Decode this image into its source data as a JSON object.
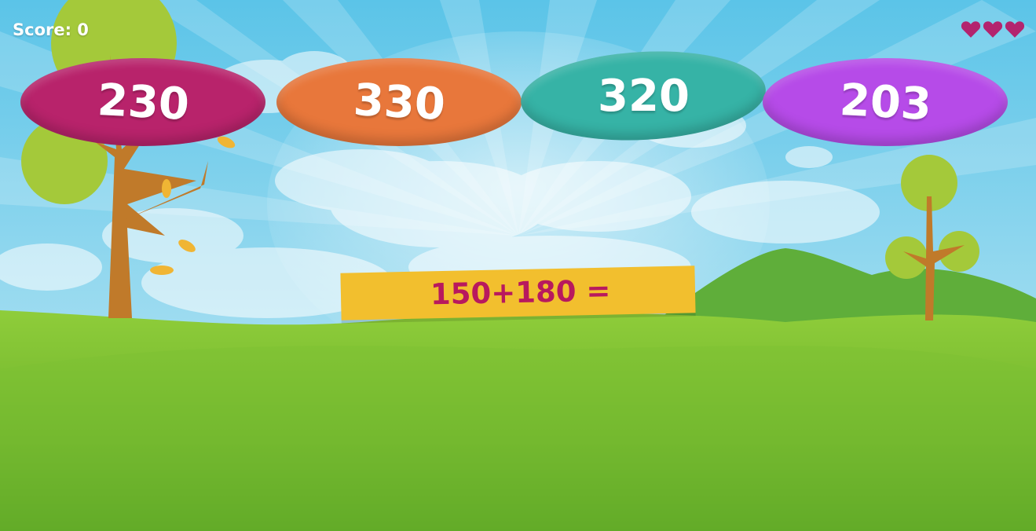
{
  "hud": {
    "score_text": "Score: 0",
    "lives": 3,
    "heart_color": "#b3246e"
  },
  "answers": [
    {
      "label": "230",
      "color": "#b8236b"
    },
    {
      "label": "330",
      "color": "#e8773b"
    },
    {
      "label": "320",
      "color": "#36b3a6"
    },
    {
      "label": "203",
      "color": "#b64be8"
    }
  ],
  "question": {
    "text": "150+180 =",
    "board_color": "#f2bf2e"
  },
  "colors": {
    "sky_top": "#5bc4e8",
    "sky_bottom": "#c8ebf5",
    "grass_light": "#8fcd3a",
    "grass_dark": "#4e9a20",
    "hill_far": "#5fae3a",
    "tree_trunk": "#c07a2a",
    "tree_leaf": "#a4c93a"
  }
}
